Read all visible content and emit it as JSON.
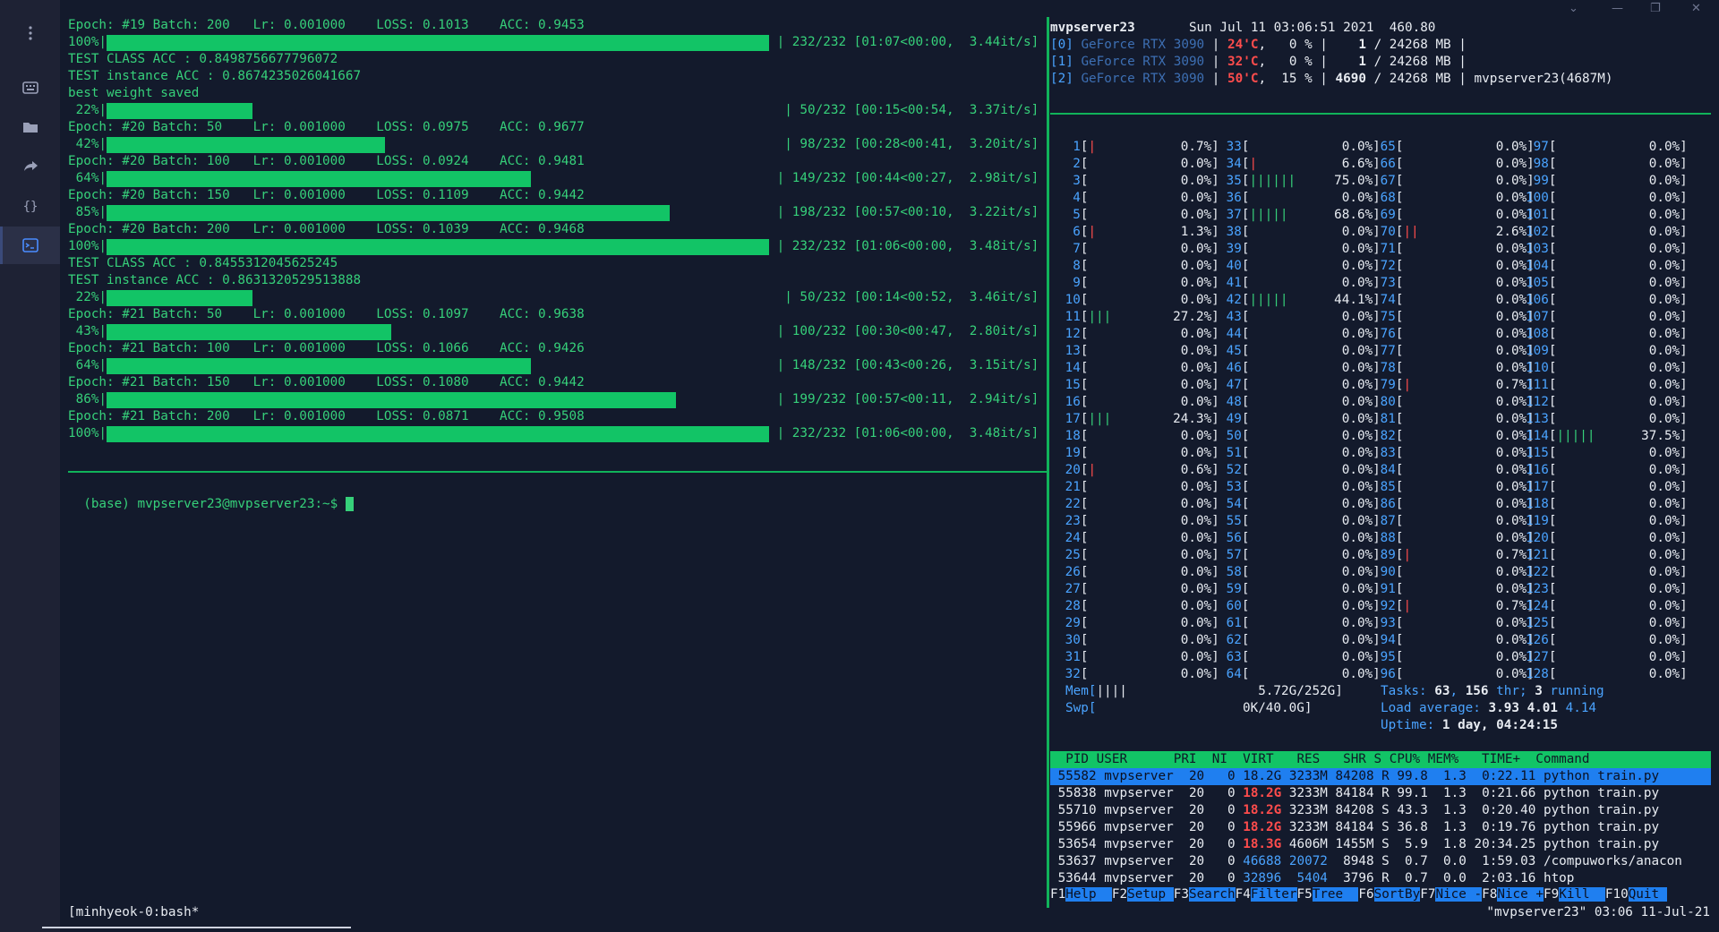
{
  "sidebar": {
    "icons": [
      "more-vert-icon",
      "keyboard-icon",
      "folder-icon",
      "share-icon",
      "code-braces-icon",
      "terminal-icon"
    ]
  },
  "window_controls": [
    "chevron-down-icon",
    "minimize-icon",
    "restore-icon",
    "close-icon"
  ],
  "left_pane": {
    "lines": [
      {
        "t": "Epoch: #19 Batch: 200   Lr: 0.001000    LOSS: 0.1013    ACC: 0.9453"
      },
      {
        "t": "100%|",
        "bar": 1.0,
        "rest": "| 232/232 [01:07<00:00,  3.44it/s]"
      },
      {
        "t": "TEST CLASS ACC : 0.8498756677796072"
      },
      {
        "t": "TEST instance ACC : 0.8674235026041667"
      },
      {
        "t": "best weight saved"
      },
      {
        "t": " 22%|",
        "bar": 0.22,
        "rest": "| 50/232 [00:15<00:54,  3.37it/s]"
      },
      {
        "t": "Epoch: #20 Batch: 50    Lr: 0.001000    LOSS: 0.0975    ACC: 0.9677"
      },
      {
        "t": " 42%|",
        "bar": 0.42,
        "rest": "| 98/232 [00:28<00:41,  3.20it/s]"
      },
      {
        "t": "Epoch: #20 Batch: 100   Lr: 0.001000    LOSS: 0.0924    ACC: 0.9481"
      },
      {
        "t": " 64%|",
        "bar": 0.64,
        "rest": "| 149/232 [00:44<00:27,  2.98it/s]"
      },
      {
        "t": "Epoch: #20 Batch: 150   Lr: 0.001000    LOSS: 0.1109    ACC: 0.9442"
      },
      {
        "t": " 85%|",
        "bar": 0.85,
        "rest": "| 198/232 [00:57<00:10,  3.22it/s]"
      },
      {
        "t": "Epoch: #20 Batch: 200   Lr: 0.001000    LOSS: 0.1039    ACC: 0.9468"
      },
      {
        "t": "100%|",
        "bar": 1.0,
        "rest": "| 232/232 [01:06<00:00,  3.48it/s]"
      },
      {
        "t": "TEST CLASS ACC : 0.8455312045625245"
      },
      {
        "t": "TEST instance ACC : 0.8631320529513888"
      },
      {
        "t": " 22%|",
        "bar": 0.22,
        "rest": "| 50/232 [00:14<00:52,  3.46it/s]"
      },
      {
        "t": "Epoch: #21 Batch: 50    Lr: 0.001000    LOSS: 0.1097    ACC: 0.9638"
      },
      {
        "t": " 43%|",
        "bar": 0.43,
        "rest": "| 100/232 [00:30<00:47,  2.80it/s]"
      },
      {
        "t": "Epoch: #21 Batch: 100   Lr: 0.001000    LOSS: 0.1066    ACC: 0.9426"
      },
      {
        "t": " 64%|",
        "bar": 0.64,
        "rest": "| 148/232 [00:43<00:26,  3.15it/s]"
      },
      {
        "t": "Epoch: #21 Batch: 150   Lr: 0.001000    LOSS: 0.1080    ACC: 0.9442"
      },
      {
        "t": " 86%|",
        "bar": 0.86,
        "rest": "| 199/232 [00:57<00:11,  2.94it/s]"
      },
      {
        "t": "Epoch: #21 Batch: 200   Lr: 0.001000    LOSS: 0.0871    ACC: 0.9508"
      },
      {
        "t": "100%|",
        "bar": 1.0,
        "rest": "| 232/232 [01:06<00:00,  3.48it/s]"
      }
    ],
    "prompt": "(base) mvpserver23@mvpserver23:~$ "
  },
  "gpustat": {
    "host": "mvpserver23",
    "datetime": "Sun Jul 11 03:06:51 2021",
    "driver": "460.80",
    "gpus": [
      {
        "idx": "[0]",
        "name": "GeForce RTX 3090",
        "temp": "24'C",
        "util": "  0 %",
        "mem_used": "   1",
        "mem_total": "24268 MB",
        "procs": ""
      },
      {
        "idx": "[1]",
        "name": "GeForce RTX 3090",
        "temp": "32'C",
        "util": "  0 %",
        "mem_used": "   1",
        "mem_total": "24268 MB",
        "procs": ""
      },
      {
        "idx": "[2]",
        "name": "GeForce RTX 3090",
        "temp": "50'C",
        "util": " 15 %",
        "mem_used": "4690",
        "mem_total": "24268 MB",
        "procs": "mvpserver23(4687M)"
      }
    ]
  },
  "htop": {
    "cpu_cols": [
      [
        [
          "1",
          "[|",
          "0.7%]"
        ],
        [
          "2",
          "[",
          "0.0%]"
        ],
        [
          "3",
          "[",
          "0.0%]"
        ],
        [
          "4",
          "[",
          "0.0%]"
        ],
        [
          "5",
          "[",
          "0.0%]"
        ],
        [
          "6",
          "[|",
          "1.3%]"
        ],
        [
          "7",
          "[",
          "0.0%]"
        ],
        [
          "8",
          "[",
          "0.0%]"
        ],
        [
          "9",
          "[",
          "0.0%]"
        ],
        [
          "10",
          "[",
          "0.0%]"
        ],
        [
          "11",
          "[|||",
          "27.2%]"
        ],
        [
          "12",
          "[",
          "0.0%]"
        ],
        [
          "13",
          "[",
          "0.0%]"
        ],
        [
          "14",
          "[",
          "0.0%]"
        ],
        [
          "15",
          "[",
          "0.0%]"
        ],
        [
          "16",
          "[",
          "0.0%]"
        ],
        [
          "17",
          "[|||",
          "24.3%]"
        ],
        [
          "18",
          "[",
          "0.0%]"
        ],
        [
          "19",
          "[",
          "0.0%]"
        ],
        [
          "20",
          "[|",
          "0.6%]"
        ],
        [
          "21",
          "[",
          "0.0%]"
        ],
        [
          "22",
          "[",
          "0.0%]"
        ],
        [
          "23",
          "[",
          "0.0%]"
        ],
        [
          "24",
          "[",
          "0.0%]"
        ],
        [
          "25",
          "[",
          "0.0%]"
        ],
        [
          "26",
          "[",
          "0.0%]"
        ],
        [
          "27",
          "[",
          "0.0%]"
        ],
        [
          "28",
          "[",
          "0.0%]"
        ],
        [
          "29",
          "[",
          "0.0%]"
        ],
        [
          "30",
          "[",
          "0.0%]"
        ],
        [
          "31",
          "[",
          "0.0%]"
        ],
        [
          "32",
          "[",
          "0.0%]"
        ]
      ],
      [
        [
          "33",
          "[",
          "0.0%]"
        ],
        [
          "34",
          "[|",
          "6.6%]"
        ],
        [
          "35",
          "[||||||",
          "75.0%]"
        ],
        [
          "36",
          "[",
          "0.0%]"
        ],
        [
          "37",
          "[|||||",
          "68.6%]"
        ],
        [
          "38",
          "[",
          "0.0%]"
        ],
        [
          "39",
          "[",
          "0.0%]"
        ],
        [
          "40",
          "[",
          "0.0%]"
        ],
        [
          "41",
          "[",
          "0.0%]"
        ],
        [
          "42",
          "[|||||",
          "44.1%]"
        ],
        [
          "43",
          "[",
          "0.0%]"
        ],
        [
          "44",
          "[",
          "0.0%]"
        ],
        [
          "45",
          "[",
          "0.0%]"
        ],
        [
          "46",
          "[",
          "0.0%]"
        ],
        [
          "47",
          "[",
          "0.0%]"
        ],
        [
          "48",
          "[",
          "0.0%]"
        ],
        [
          "49",
          "[",
          "0.0%]"
        ],
        [
          "50",
          "[",
          "0.0%]"
        ],
        [
          "51",
          "[",
          "0.0%]"
        ],
        [
          "52",
          "[",
          "0.0%]"
        ],
        [
          "53",
          "[",
          "0.0%]"
        ],
        [
          "54",
          "[",
          "0.0%]"
        ],
        [
          "55",
          "[",
          "0.0%]"
        ],
        [
          "56",
          "[",
          "0.0%]"
        ],
        [
          "57",
          "[",
          "0.0%]"
        ],
        [
          "58",
          "[",
          "0.0%]"
        ],
        [
          "59",
          "[",
          "0.0%]"
        ],
        [
          "60",
          "[",
          "0.0%]"
        ],
        [
          "61",
          "[",
          "0.0%]"
        ],
        [
          "62",
          "[",
          "0.0%]"
        ],
        [
          "63",
          "[",
          "0.0%]"
        ],
        [
          "64",
          "[",
          "0.0%]"
        ]
      ],
      [
        [
          "65",
          "[",
          "0.0%]"
        ],
        [
          "66",
          "[",
          "0.0%]"
        ],
        [
          "67",
          "[",
          "0.0%]"
        ],
        [
          "68",
          "[",
          "0.0%]"
        ],
        [
          "69",
          "[",
          "0.0%]"
        ],
        [
          "70",
          "[||",
          "2.6%]"
        ],
        [
          "71",
          "[",
          "0.0%]"
        ],
        [
          "72",
          "[",
          "0.0%]"
        ],
        [
          "73",
          "[",
          "0.0%]"
        ],
        [
          "74",
          "[",
          "0.0%]"
        ],
        [
          "75",
          "[",
          "0.0%]"
        ],
        [
          "76",
          "[",
          "0.0%]"
        ],
        [
          "77",
          "[",
          "0.0%]"
        ],
        [
          "78",
          "[",
          "0.0%]"
        ],
        [
          "79",
          "[|",
          "0.7%]"
        ],
        [
          "80",
          "[",
          "0.0%]"
        ],
        [
          "81",
          "[",
          "0.0%]"
        ],
        [
          "82",
          "[",
          "0.0%]"
        ],
        [
          "83",
          "[",
          "0.0%]"
        ],
        [
          "84",
          "[",
          "0.0%]"
        ],
        [
          "85",
          "[",
          "0.0%]"
        ],
        [
          "86",
          "[",
          "0.0%]"
        ],
        [
          "87",
          "[",
          "0.0%]"
        ],
        [
          "88",
          "[",
          "0.0%]"
        ],
        [
          "89",
          "[|",
          "0.7%]"
        ],
        [
          "90",
          "[",
          "0.0%]"
        ],
        [
          "91",
          "[",
          "0.0%]"
        ],
        [
          "92",
          "[|",
          "0.7%]"
        ],
        [
          "93",
          "[",
          "0.0%]"
        ],
        [
          "94",
          "[",
          "0.0%]"
        ],
        [
          "95",
          "[",
          "0.0%]"
        ],
        [
          "96",
          "[",
          "0.0%]"
        ]
      ],
      [
        [
          "97",
          "[",
          "0.0%]"
        ],
        [
          "98",
          "[",
          "0.0%]"
        ],
        [
          "99",
          "[",
          "0.0%]"
        ],
        [
          "100",
          "[",
          "0.0%]"
        ],
        [
          "101",
          "[",
          "0.0%]"
        ],
        [
          "102",
          "[",
          "0.0%]"
        ],
        [
          "103",
          "[",
          "0.0%]"
        ],
        [
          "104",
          "[",
          "0.0%]"
        ],
        [
          "105",
          "[",
          "0.0%]"
        ],
        [
          "106",
          "[",
          "0.0%]"
        ],
        [
          "107",
          "[",
          "0.0%]"
        ],
        [
          "108",
          "[",
          "0.0%]"
        ],
        [
          "109",
          "[",
          "0.0%]"
        ],
        [
          "110",
          "[",
          "0.0%]"
        ],
        [
          "111",
          "[",
          "0.0%]"
        ],
        [
          "112",
          "[",
          "0.0%]"
        ],
        [
          "113",
          "[",
          "0.0%]"
        ],
        [
          "114",
          "[|||||",
          "37.5%]"
        ],
        [
          "115",
          "[",
          "0.0%]"
        ],
        [
          "116",
          "[",
          "0.0%]"
        ],
        [
          "117",
          "[",
          "0.0%]"
        ],
        [
          "118",
          "[",
          "0.0%]"
        ],
        [
          "119",
          "[",
          "0.0%]"
        ],
        [
          "120",
          "[",
          "0.0%]"
        ],
        [
          "121",
          "[",
          "0.0%]"
        ],
        [
          "122",
          "[",
          "0.0%]"
        ],
        [
          "123",
          "[",
          "0.0%]"
        ],
        [
          "124",
          "[",
          "0.0%]"
        ],
        [
          "125",
          "[",
          "0.0%]"
        ],
        [
          "126",
          "[",
          "0.0%]"
        ],
        [
          "127",
          "[",
          "0.0%]"
        ],
        [
          "128",
          "[",
          "0.0%]"
        ]
      ]
    ],
    "mem": {
      "label": "Mem[",
      "bar": "||||",
      "value": "5.72G/252G]"
    },
    "swp": {
      "label": "Swp[",
      "bar": "",
      "value": "0K/40.0G]"
    },
    "tasks": {
      "prefix": "Tasks: ",
      "tasks": "63",
      "sep1": ", ",
      "thr": "156",
      "sep2": " thr; ",
      "running": "3",
      "suffix": " running"
    },
    "load": {
      "prefix": "Load average: ",
      "l1": "3.93",
      "l5": "4.01",
      "l15": "4.14"
    },
    "uptime": {
      "prefix": "Uptime: ",
      "value": "1 day, 04:24:15"
    },
    "proc_header": "  PID USER      PRI  NI  VIRT   RES   SHR S CPU% MEM%   TIME+  Command",
    "procs": [
      {
        "pid": "55582",
        "user": "mvpserver",
        "pri": "20",
        "ni": "0",
        "virt": "18.2G",
        "res": "3233M",
        "shr": "84208",
        "s": "R",
        "cpu": "99.8",
        "mem": "1.3",
        "time": "0:22.11",
        "cmd": "python train.py",
        "sel": true
      },
      {
        "pid": "55838",
        "user": "mvpserver",
        "pri": "20",
        "ni": "0",
        "virt": "18.2G",
        "res": "3233M",
        "shr": "84184",
        "s": "R",
        "cpu": "99.1",
        "mem": "1.3",
        "time": "0:21.66",
        "cmd": "python train.py",
        "big": true
      },
      {
        "pid": "55710",
        "user": "mvpserver",
        "pri": "20",
        "ni": "0",
        "virt": "18.2G",
        "res": "3233M",
        "shr": "84208",
        "s": "S",
        "cpu": "43.3",
        "mem": "1.3",
        "time": "0:20.40",
        "cmd": "python train.py",
        "big": true
      },
      {
        "pid": "55966",
        "user": "mvpserver",
        "pri": "20",
        "ni": "0",
        "virt": "18.2G",
        "res": "3233M",
        "shr": "84184",
        "s": "S",
        "cpu": "36.8",
        "mem": "1.3",
        "time": "0:19.76",
        "cmd": "python train.py",
        "big": true
      },
      {
        "pid": "53654",
        "user": "mvpserver",
        "pri": "20",
        "ni": "0",
        "virt": "18.3G",
        "res": "4606M",
        "shr": "1455M",
        "s": "S",
        "cpu": "5.9",
        "mem": "1.8",
        "time": "20:34.25",
        "cmd": "python train.py",
        "big": true
      },
      {
        "pid": "53637",
        "user": "mvpserver",
        "pri": "20",
        "ni": "0",
        "virt": "46688",
        "res": "20072",
        "shr": "8948",
        "s": "S",
        "cpu": "0.7",
        "mem": "0.0",
        "time": "1:59.03",
        "cmd": "/compuworks/anacon"
      },
      {
        "pid": "53644",
        "user": "mvpserver",
        "pri": "20",
        "ni": "0",
        "virt": "32896",
        "res": "5404",
        "shr": "3796",
        "s": "R",
        "cpu": "0.7",
        "mem": "0.0",
        "time": "2:03.16",
        "cmd": "htop"
      }
    ],
    "fkeys": [
      {
        "k": "F1",
        "l": "Help  "
      },
      {
        "k": "F2",
        "l": "Setup "
      },
      {
        "k": "F3",
        "l": "Search"
      },
      {
        "k": "F4",
        "l": "Filter"
      },
      {
        "k": "F5",
        "l": "Tree  "
      },
      {
        "k": "F6",
        "l": "SortBy"
      },
      {
        "k": "F7",
        "l": "Nice -"
      },
      {
        "k": "F8",
        "l": "Nice +"
      },
      {
        "k": "F9",
        "l": "Kill  "
      },
      {
        "k": "F10",
        "l": "Quit "
      }
    ]
  },
  "status": {
    "left": "[minhyeok-0:bash*",
    "right": "\"mvpserver23\" 03:06 11-Jul-21"
  }
}
